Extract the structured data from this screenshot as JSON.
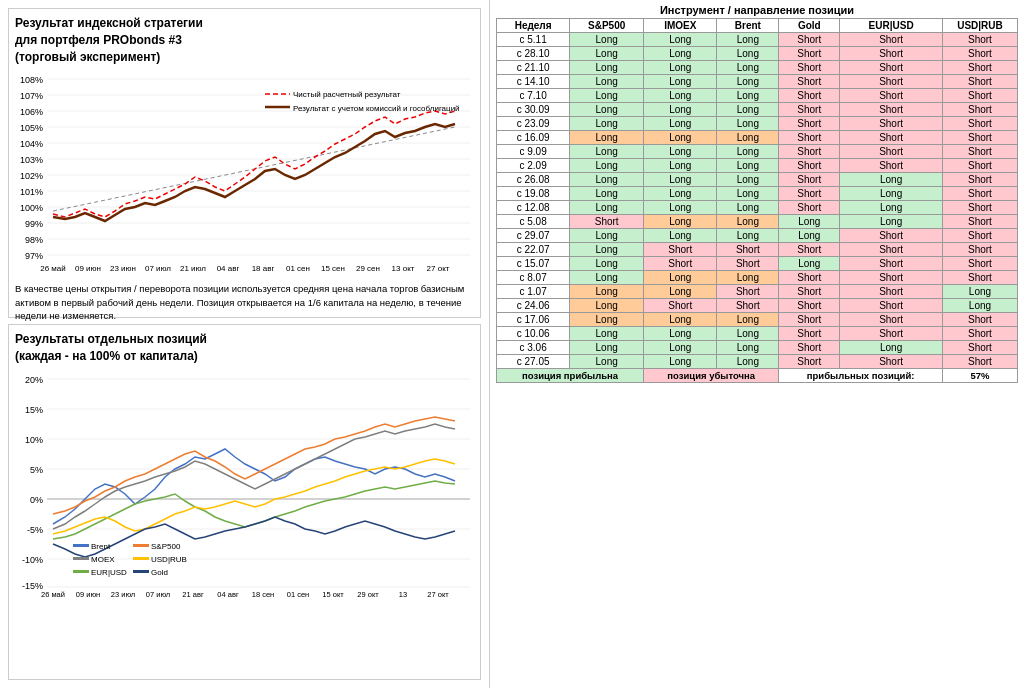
{
  "left": {
    "top_chart": {
      "title": "Результат индексной стратегии\nдля портфеля PRObonds #3\n(торговый эксперимент)",
      "note": "В качестве цены открытия / переворота позиции используется средняя цена начала торгов базисным активом в первый рабочий день недели. Позиция открывается на 1/6 капитала на неделю, в течение недели не изменяется.",
      "legend1": "Чистый расчетный результат",
      "legend2": "Результат с учетом комиссий и гособлигаций",
      "y_labels": [
        "108%",
        "107%",
        "106%",
        "105%",
        "104%",
        "103%",
        "102%",
        "101%",
        "100%",
        "99%",
        "98%",
        "97%"
      ],
      "x_labels": [
        "26 май",
        "09 июн",
        "23 июн",
        "07 июл",
        "21 июл",
        "04 авг",
        "18 авг",
        "01 сен",
        "15 сен",
        "29 сен",
        "13 окт",
        "27 окт"
      ]
    },
    "bottom_chart": {
      "title": "Результаты отдельных позиций\n(каждая - на 100% от капитала)",
      "y_labels": [
        "20%",
        "15%",
        "10%",
        "5%",
        "0%",
        "-5%",
        "-10%",
        "-15%"
      ],
      "x_labels": [
        "26 май",
        "09 июн",
        "23 июл",
        "07 июл",
        "21 авг",
        "04 авг",
        "18 сен",
        "01 сен",
        "15 окт",
        "29 окт",
        "13",
        "27 окт"
      ],
      "legend": [
        {
          "label": "Brent",
          "color": "#4472c4"
        },
        {
          "label": "S&P500",
          "color": "#ed7d31"
        },
        {
          "label": "MOEX",
          "color": "#808080"
        },
        {
          "label": "USD|RUB",
          "color": "#ffc000"
        },
        {
          "label": "EUR|USD",
          "color": "#70ad47"
        },
        {
          "label": "Gold",
          "color": "#264478"
        }
      ]
    }
  },
  "right": {
    "header": "Инструмент / направление позиции",
    "week_col": "Неделя",
    "columns": [
      "S&P500",
      "IMOEX",
      "Brent",
      "Gold",
      "EUR|USD",
      "USD|RUB"
    ],
    "rows": [
      {
        "week": "с 5.11",
        "sp500": "Long",
        "imoex": "Long",
        "brent": "Long",
        "gold": "Short",
        "eurusd": "Short",
        "usdrub": "Short"
      },
      {
        "week": "с 28.10",
        "sp500": "Long",
        "imoex": "Long",
        "brent": "Long",
        "gold": "Short",
        "eurusd": "Short",
        "usdrub": "Short"
      },
      {
        "week": "с 21.10",
        "sp500": "Long",
        "imoex": "Long",
        "brent": "Long",
        "gold": "Short",
        "eurusd": "Short",
        "usdrub": "Short"
      },
      {
        "week": "с 14.10",
        "sp500": "Long",
        "imoex": "Long",
        "brent": "Long",
        "gold": "Short",
        "eurusd": "Short",
        "usdrub": "Short"
      },
      {
        "week": "с 7.10",
        "sp500": "Long",
        "imoex": "Long",
        "brent": "Long",
        "gold": "Short",
        "eurusd": "Short",
        "usdrub": "Short"
      },
      {
        "week": "с 30.09",
        "sp500": "Long",
        "imoex": "Long",
        "brent": "Long",
        "gold": "Short",
        "eurusd": "Short",
        "usdrub": "Short"
      },
      {
        "week": "с 23.09",
        "sp500": "Long",
        "imoex": "Long",
        "brent": "Long",
        "gold": "Short",
        "eurusd": "Short",
        "usdrub": "Short"
      },
      {
        "week": "с 16.09",
        "sp500": "Long",
        "imoex": "Long",
        "brent": "Long",
        "gold": "Short",
        "eurusd": "Short",
        "usdrub": "Short"
      },
      {
        "week": "с 9.09",
        "sp500": "Long",
        "imoex": "Long",
        "brent": "Long",
        "gold": "Short",
        "eurusd": "Short",
        "usdrub": "Short"
      },
      {
        "week": "с 2.09",
        "sp500": "Long",
        "imoex": "Long",
        "brent": "Long",
        "gold": "Short",
        "eurusd": "Short",
        "usdrub": "Short"
      },
      {
        "week": "с 26.08",
        "sp500": "Long",
        "imoex": "Long",
        "brent": "Long",
        "gold": "Short",
        "eurusd": "Long",
        "usdrub": "Short"
      },
      {
        "week": "с 19.08",
        "sp500": "Long",
        "imoex": "Long",
        "brent": "Long",
        "gold": "Short",
        "eurusd": "Long",
        "usdrub": "Short"
      },
      {
        "week": "с 12.08",
        "sp500": "Long",
        "imoex": "Long",
        "brent": "Long",
        "gold": "Short",
        "eurusd": "Long",
        "usdrub": "Short"
      },
      {
        "week": "с 5.08",
        "sp500": "Short",
        "imoex": "Long",
        "brent": "Long",
        "gold": "Long",
        "eurusd": "Long",
        "usdrub": "Short"
      },
      {
        "week": "с 29.07",
        "sp500": "Long",
        "imoex": "Long",
        "brent": "Long",
        "gold": "Long",
        "eurusd": "Short",
        "usdrub": "Short"
      },
      {
        "week": "с 22.07",
        "sp500": "Long",
        "imoex": "Short",
        "brent": "Short",
        "gold": "Short",
        "eurusd": "Short",
        "usdrub": "Short"
      },
      {
        "week": "с 15.07",
        "sp500": "Long",
        "imoex": "Short",
        "brent": "Short",
        "gold": "Long",
        "eurusd": "Short",
        "usdrub": "Short"
      },
      {
        "week": "с 8.07",
        "sp500": "Long",
        "imoex": "Long",
        "brent": "Long",
        "gold": "Short",
        "eurusd": "Short",
        "usdrub": "Short"
      },
      {
        "week": "с 1.07",
        "sp500": "Long",
        "imoex": "Long",
        "brent": "Short",
        "gold": "Short",
        "eurusd": "Short",
        "usdrub": "Long"
      },
      {
        "week": "с 24.06",
        "sp500": "Long",
        "imoex": "Short",
        "brent": "Short",
        "gold": "Short",
        "eurusd": "Short",
        "usdrub": "Long"
      },
      {
        "week": "с 17.06",
        "sp500": "Long",
        "imoex": "Long",
        "brent": "Long",
        "gold": "Short",
        "eurusd": "Short",
        "usdrub": "Short"
      },
      {
        "week": "с 10.06",
        "sp500": "Long",
        "imoex": "Long",
        "brent": "Long",
        "gold": "Short",
        "eurusd": "Short",
        "usdrub": "Short"
      },
      {
        "week": "с 3.06",
        "sp500": "Long",
        "imoex": "Long",
        "brent": "Long",
        "gold": "Short",
        "eurusd": "Long",
        "usdrub": "Short"
      },
      {
        "week": "с 27.05",
        "sp500": "Long",
        "imoex": "Long",
        "brent": "Long",
        "gold": "Short",
        "eurusd": "Short",
        "usdrub": "Short"
      }
    ],
    "footer": {
      "profitable": "позиция прибыльна",
      "losing": "позиция убыточна",
      "label": "прибыльных позиций:",
      "pct": "57%"
    }
  }
}
